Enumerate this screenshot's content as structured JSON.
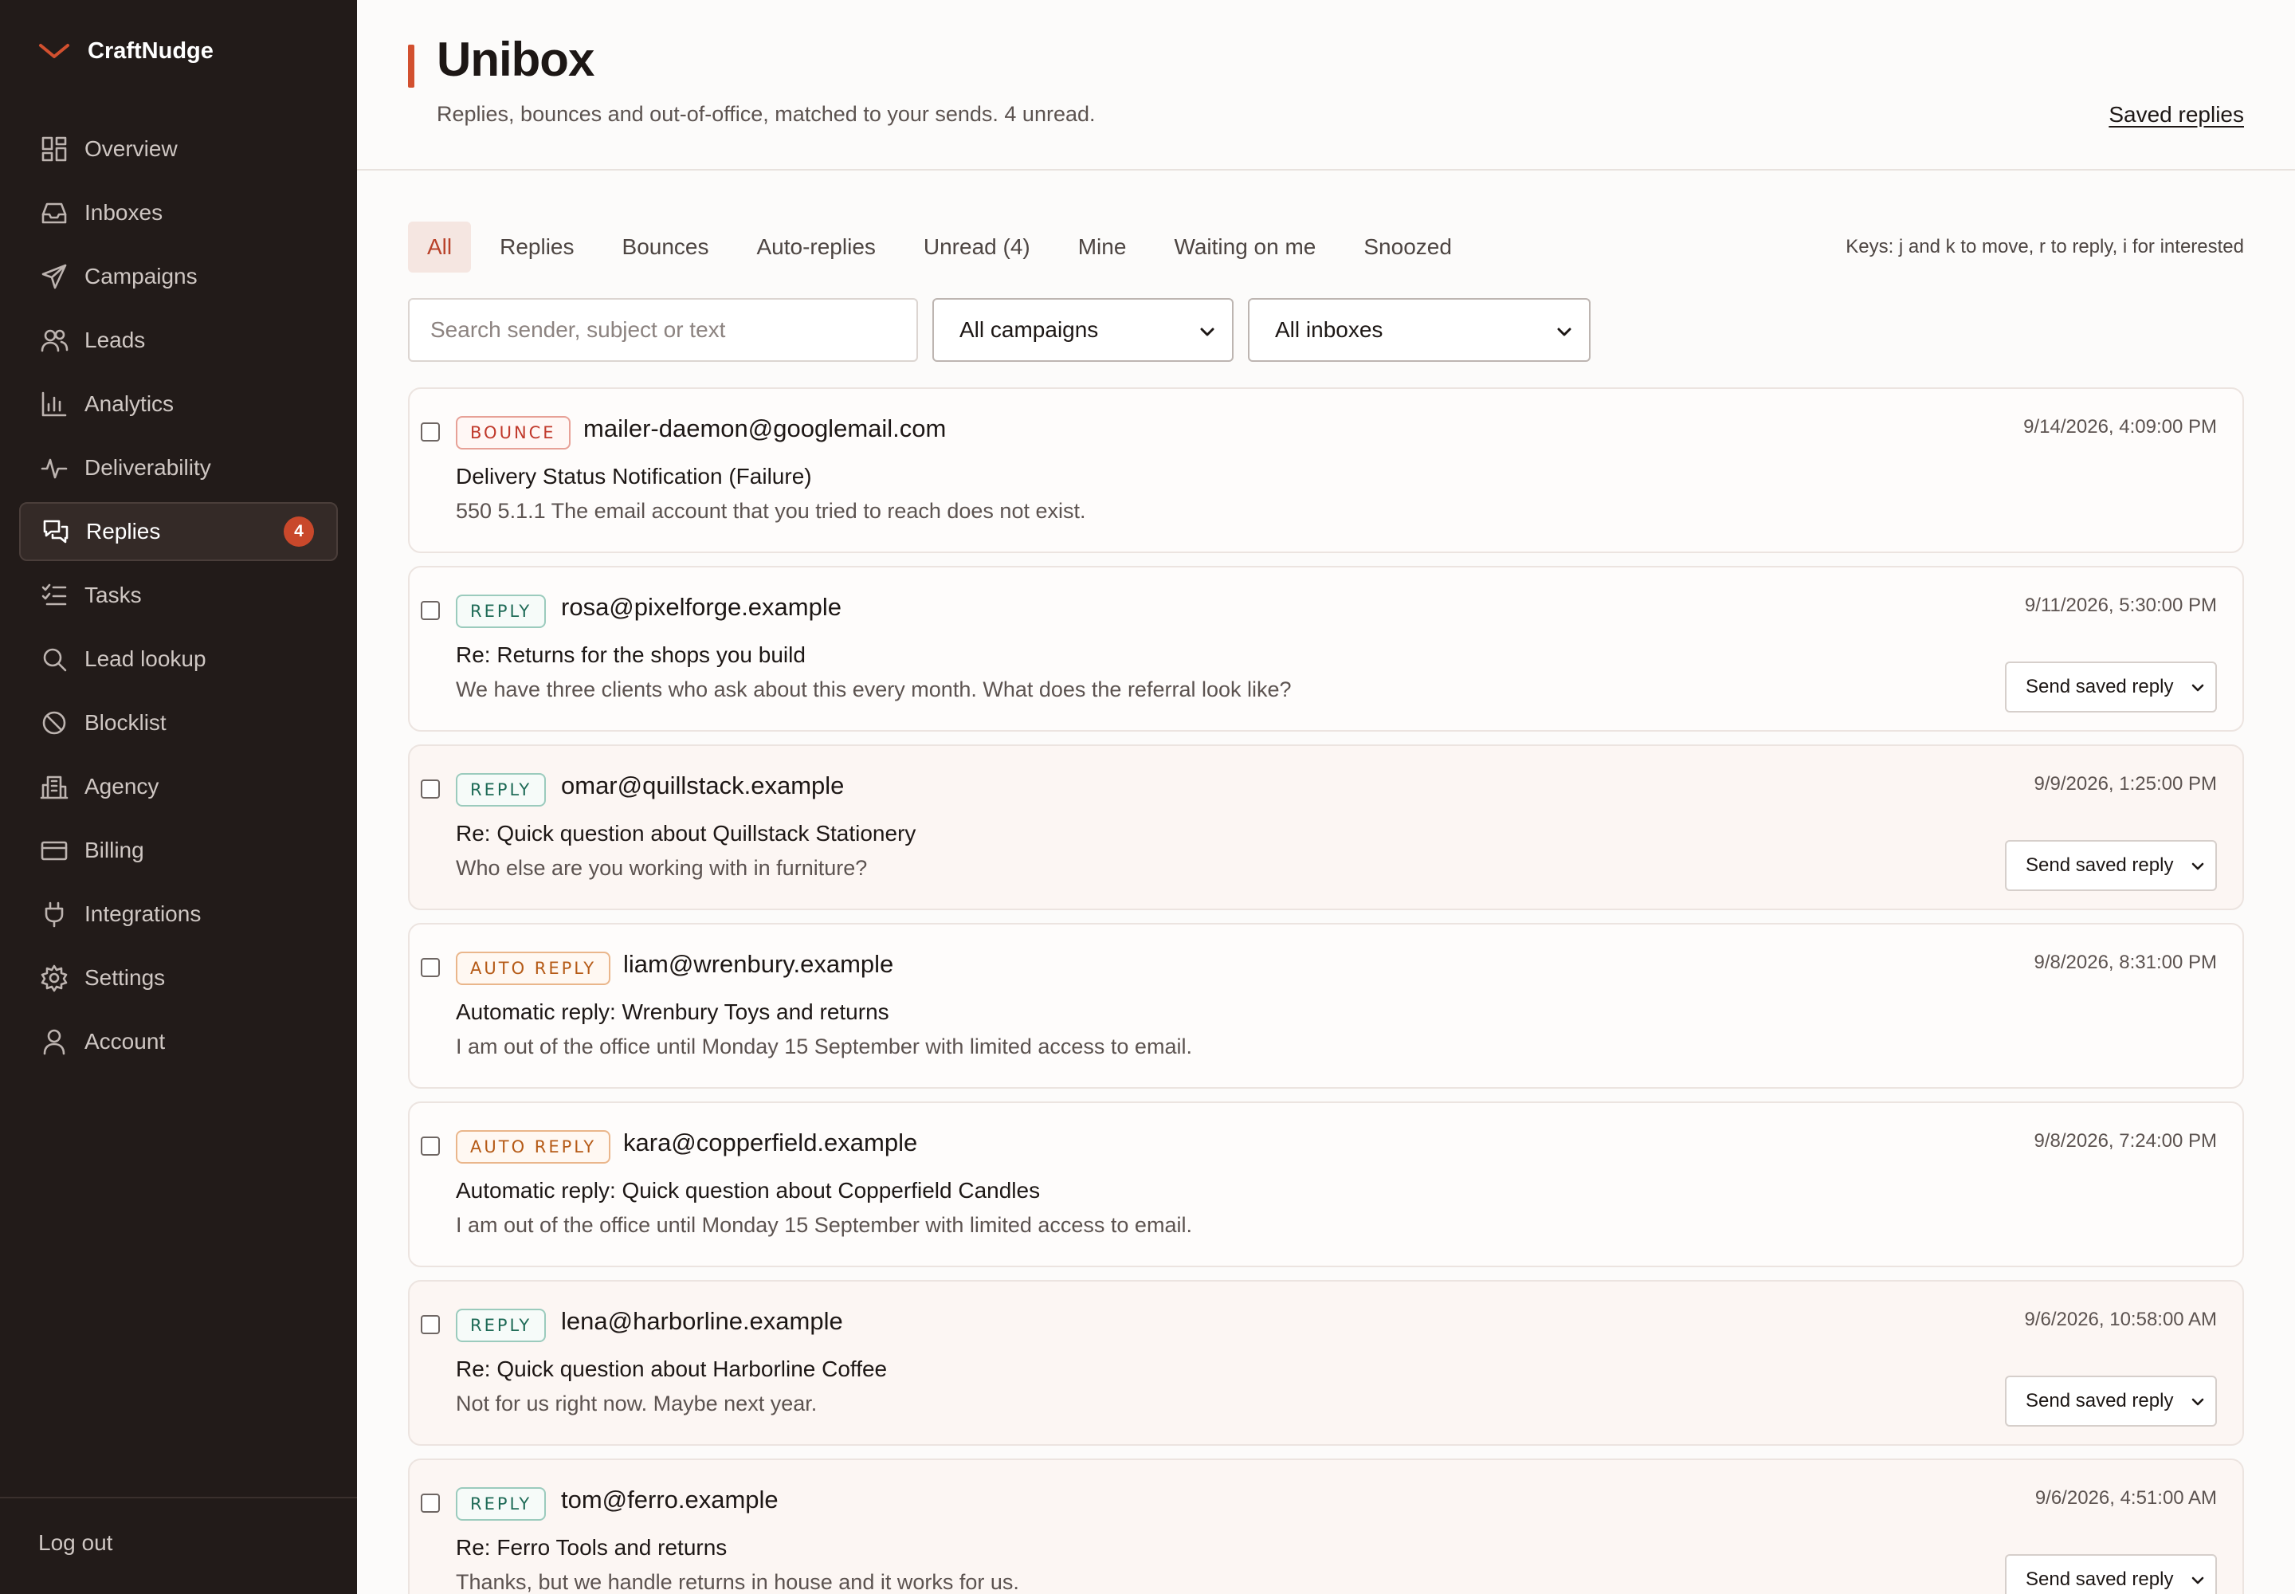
{
  "brand": {
    "name": "CraftNudge",
    "icon": "chevron-down-icon",
    "accent": "#d2502f"
  },
  "sidebar": {
    "items": [
      {
        "label": "Overview",
        "icon": "grid-icon"
      },
      {
        "label": "Inboxes",
        "icon": "inbox-tray-icon"
      },
      {
        "label": "Campaigns",
        "icon": "paper-plane-icon"
      },
      {
        "label": "Leads",
        "icon": "users-icon"
      },
      {
        "label": "Analytics",
        "icon": "bar-chart-icon"
      },
      {
        "label": "Deliverability",
        "icon": "pulse-icon"
      },
      {
        "label": "Replies",
        "icon": "chat-bubbles-icon",
        "active": true,
        "badge": "4"
      },
      {
        "label": "Tasks",
        "icon": "checklist-icon"
      },
      {
        "label": "Lead lookup",
        "icon": "search-icon"
      },
      {
        "label": "Blocklist",
        "icon": "ban-icon"
      },
      {
        "label": "Agency",
        "icon": "building-icon"
      },
      {
        "label": "Billing",
        "icon": "credit-card-icon"
      },
      {
        "label": "Integrations",
        "icon": "plug-icon"
      },
      {
        "label": "Settings",
        "icon": "gear-icon"
      },
      {
        "label": "Account",
        "icon": "user-icon"
      }
    ],
    "logout": "Log out"
  },
  "header": {
    "title": "Unibox",
    "subtitle": "Replies, bounces and out-of-office, matched to your sends. 4 unread.",
    "saved_replies_link": "Saved replies"
  },
  "tabs": [
    {
      "label": "All",
      "active": true
    },
    {
      "label": "Replies"
    },
    {
      "label": "Bounces"
    },
    {
      "label": "Auto-replies"
    },
    {
      "label": "Unread (4)"
    },
    {
      "label": "Mine"
    },
    {
      "label": "Waiting on me"
    },
    {
      "label": "Snoozed"
    }
  ],
  "keys_hint": "Keys: j and k to move, r to reply, i for interested",
  "filters": {
    "search_placeholder": "Search sender, subject or text",
    "campaign_select": "All campaigns",
    "inbox_select": "All inboxes"
  },
  "saved_reply_label": "Send saved reply",
  "messages": [
    {
      "type": "bounce",
      "badge": "BOUNCE",
      "sender": "mailer-daemon@googlemail.com",
      "subject": "Delivery Status Notification (Failure)",
      "snippet": "550 5.1.1 The email account that you tried to reach does not exist.",
      "date": "9/14/2026, 4:09:00 PM",
      "has_action": false
    },
    {
      "type": "reply",
      "badge": "REPLY",
      "sender": "rosa@pixelforge.example",
      "subject": "Re: Returns for the shops you build",
      "snippet": "We have three clients who ask about this every month. What does the referral look like?",
      "date": "9/11/2026, 5:30:00 PM",
      "has_action": true
    },
    {
      "type": "reply",
      "badge": "REPLY",
      "sender": "omar@quillstack.example",
      "subject": "Re: Quick question about Quillstack Stationery",
      "snippet": "Who else are you working with in furniture?",
      "date": "9/9/2026, 1:25:00 PM",
      "has_action": true
    },
    {
      "type": "auto",
      "badge": "AUTO REPLY",
      "sender": "liam@wrenbury.example",
      "subject": "Automatic reply: Wrenbury Toys and returns",
      "snippet": "I am out of the office until Monday 15 September with limited access to email.",
      "date": "9/8/2026, 8:31:00 PM",
      "has_action": false
    },
    {
      "type": "auto",
      "badge": "AUTO REPLY",
      "sender": "kara@copperfield.example",
      "subject": "Automatic reply: Quick question about Copperfield Candles",
      "snippet": "I am out of the office until Monday 15 September with limited access to email.",
      "date": "9/8/2026, 7:24:00 PM",
      "has_action": false
    },
    {
      "type": "reply",
      "badge": "REPLY",
      "sender": "lena@harborline.example",
      "subject": "Re: Quick question about Harborline Coffee",
      "snippet": "Not for us right now. Maybe next year.",
      "date": "9/6/2026, 10:58:00 AM",
      "has_action": true
    },
    {
      "type": "reply",
      "badge": "REPLY",
      "sender": "tom@ferro.example",
      "subject": "Re: Ferro Tools and returns",
      "snippet": "Thanks, but we handle returns in house and it works for us.",
      "date": "9/6/2026, 4:51:00 AM",
      "has_action": true
    }
  ]
}
